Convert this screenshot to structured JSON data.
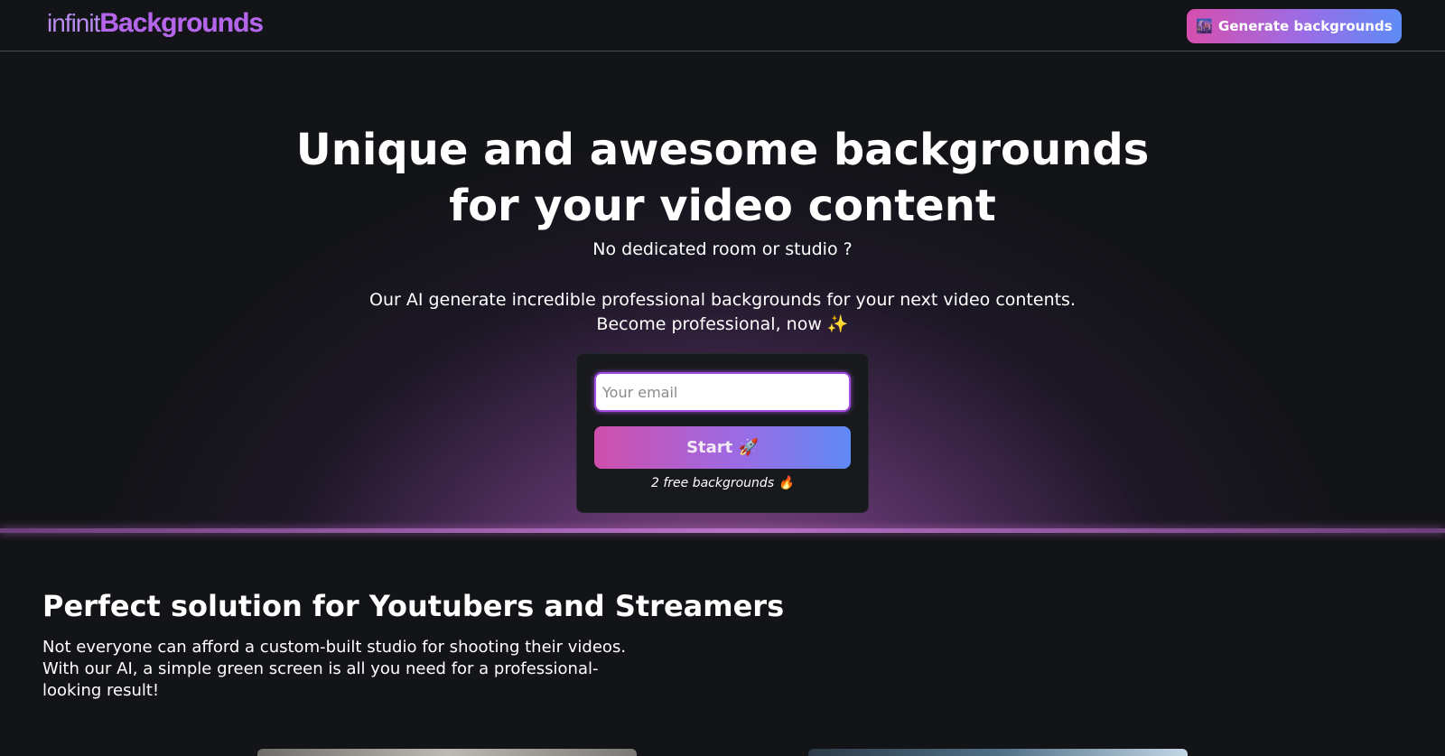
{
  "nav": {
    "logo_part1": "infinit",
    "logo_part2": "Backgrounds",
    "cta_icon": "🌆",
    "cta_label": "Generate backgrounds"
  },
  "hero": {
    "title_line1": "Unique and awesome backgrounds",
    "title_line2": "for your video content",
    "subtitle": "No dedicated room or studio ?",
    "desc_line1": "Our AI generate incredible professional backgrounds for your next video contents.",
    "desc_line2": "Become professional, now ✨"
  },
  "signup": {
    "email_placeholder": "Your email",
    "email_value": "",
    "start_label": "Start 🚀",
    "free_note": "2 free backgrounds 🔥"
  },
  "features": {
    "title": "Perfect solution for Youtubers and Streamers",
    "text_line1": "Not everyone can afford a custom-built studio for shooting their videos.",
    "text_line2": "With our AI, a simple green screen is all you need for a professional-looking result!"
  },
  "colors": {
    "background": "#121417",
    "accent_start": "#d04fab",
    "accent_end": "#5f8af6",
    "logo_accent": "#b565ea"
  }
}
